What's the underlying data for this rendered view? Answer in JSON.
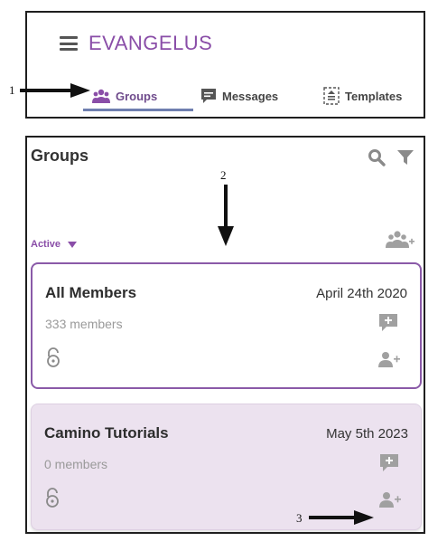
{
  "app": {
    "title": "EVANGELUS"
  },
  "tabs": [
    {
      "label": "Groups",
      "icon": "people-icon",
      "active": true
    },
    {
      "label": "Messages",
      "icon": "message-icon",
      "active": false
    },
    {
      "label": "Templates",
      "icon": "template-icon",
      "active": false
    }
  ],
  "page": {
    "title": "Groups"
  },
  "filter": {
    "label": "Active"
  },
  "groups": [
    {
      "name": "All Members",
      "date": "April 24th 2020",
      "count": "333 members"
    },
    {
      "name": "Camino Tutorials",
      "date": "May 5th 2023",
      "count": "0 members"
    }
  ],
  "annotations": [
    "1",
    "2",
    "3"
  ],
  "colors": {
    "accent": "#8a4ea8",
    "icon": "#8a8a8a",
    "highlight_card": "#ece2ef"
  }
}
